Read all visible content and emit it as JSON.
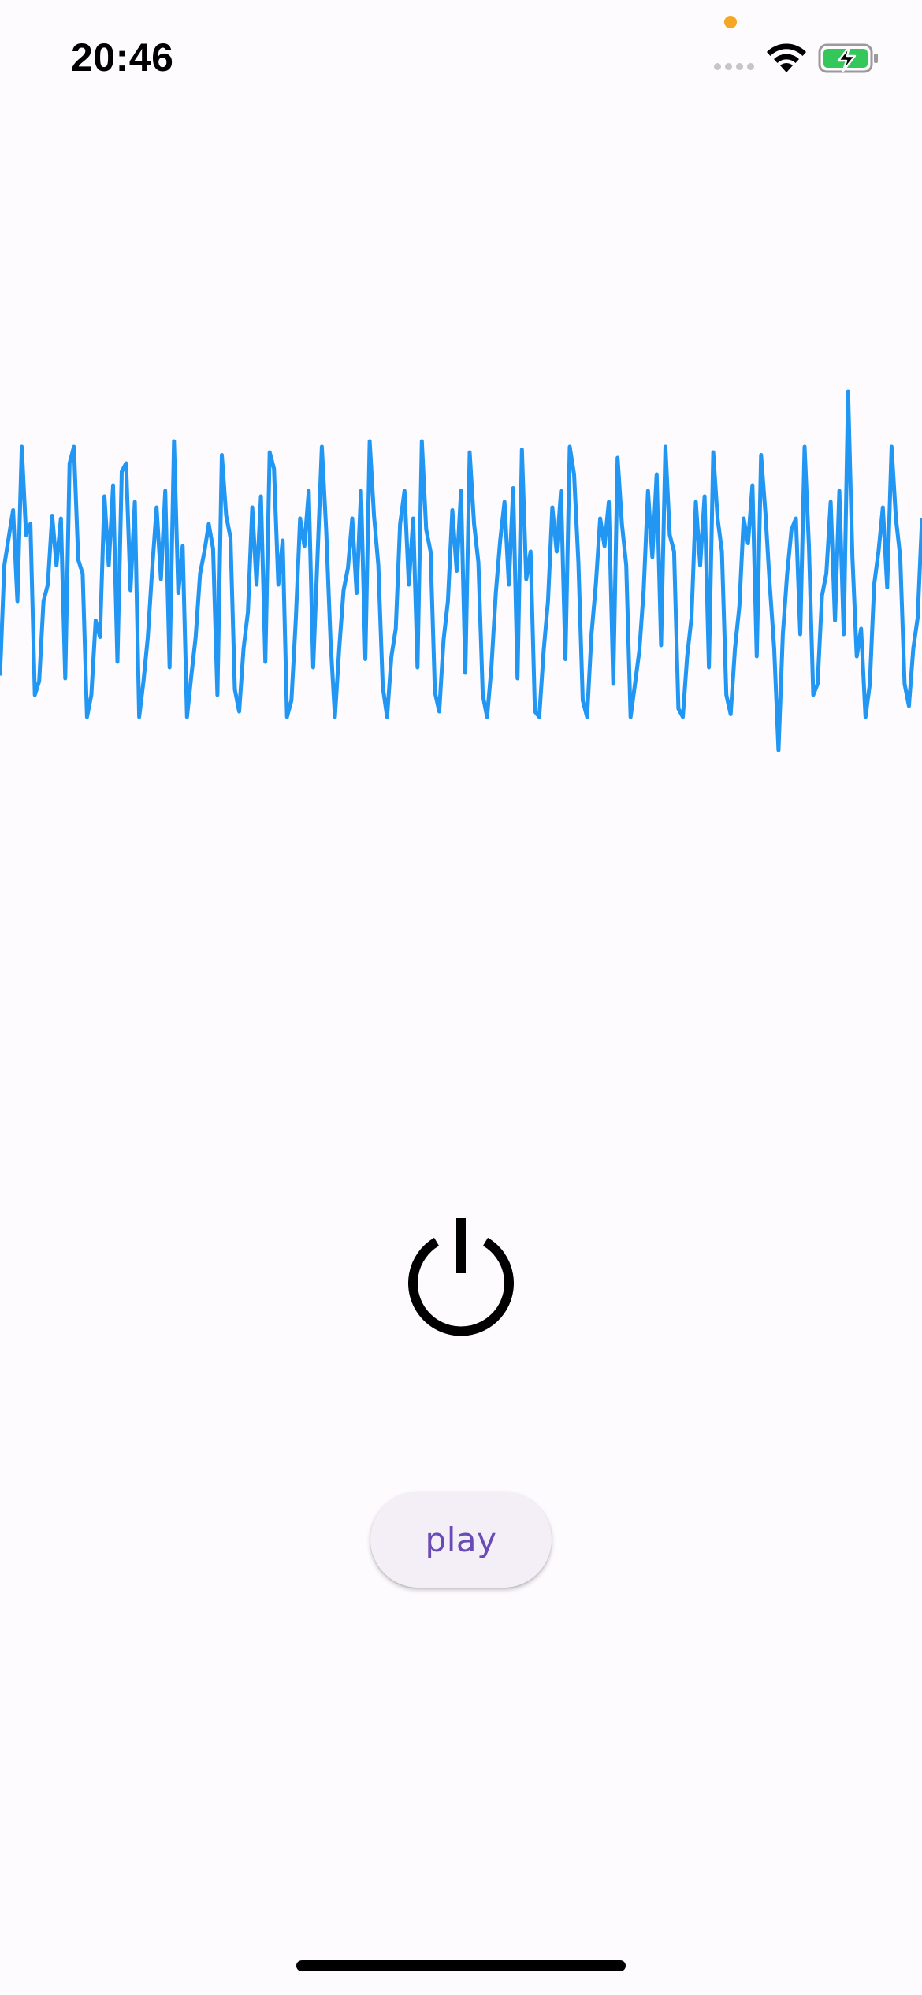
{
  "status_bar": {
    "time": "20:46",
    "wifi_icon": "wifi-icon",
    "battery_icon": "battery-charging-icon",
    "privacy_indicator_color": "#f5a623",
    "battery_color": "#34c759"
  },
  "waveform": {
    "color": "#2196f3",
    "samples": [
      0.15,
      0.55,
      0.65,
      0.75,
      0.42,
      0.98,
      0.66,
      0.7,
      0.08,
      0.13,
      0.42,
      0.48,
      0.73,
      0.55,
      0.72,
      0.14,
      0.92,
      0.98,
      0.57,
      0.52,
      0.0,
      0.08,
      0.35,
      0.29,
      0.8,
      0.55,
      0.84,
      0.2,
      0.89,
      0.92,
      0.46,
      0.78,
      0.0,
      0.13,
      0.29,
      0.54,
      0.76,
      0.5,
      0.82,
      0.18,
      1.0,
      0.45,
      0.62,
      0.0,
      0.15,
      0.29,
      0.52,
      0.6,
      0.7,
      0.61,
      0.08,
      0.95,
      0.73,
      0.65,
      0.1,
      0.02,
      0.25,
      0.38,
      0.76,
      0.48,
      0.8,
      0.2,
      0.96,
      0.9,
      0.48,
      0.64,
      0.0,
      0.06,
      0.35,
      0.72,
      0.62,
      0.82,
      0.18,
      0.58,
      0.98,
      0.68,
      0.28,
      0.0,
      0.25,
      0.46,
      0.54,
      0.72,
      0.45,
      0.82,
      0.21,
      1.0,
      0.73,
      0.55,
      0.11,
      0.0,
      0.22,
      0.32,
      0.7,
      0.82,
      0.48,
      0.72,
      0.18,
      1.0,
      0.68,
      0.6,
      0.09,
      0.02,
      0.28,
      0.42,
      0.75,
      0.53,
      0.82,
      0.16,
      0.96,
      0.7,
      0.56,
      0.08,
      0.0,
      0.18,
      0.45,
      0.64,
      0.78,
      0.48,
      0.83,
      0.14,
      0.97,
      0.5,
      0.6,
      0.02,
      0.0,
      0.24,
      0.42,
      0.76,
      0.6,
      0.82,
      0.21,
      0.98,
      0.88,
      0.56,
      0.06,
      0.0,
      0.3,
      0.48,
      0.72,
      0.62,
      0.78,
      0.12,
      0.94,
      0.7,
      0.55,
      0.0,
      0.12,
      0.24,
      0.46,
      0.82,
      0.58,
      0.88,
      0.26,
      0.98,
      0.66,
      0.6,
      0.03,
      0.0,
      0.22,
      0.36,
      0.78,
      0.55,
      0.8,
      0.18,
      0.96,
      0.72,
      0.6,
      0.08,
      0.01,
      0.25,
      0.4,
      0.72,
      0.63,
      0.84,
      0.22,
      0.95,
      0.74,
      0.48,
      0.25,
      -0.12,
      0.3,
      0.52,
      0.68,
      0.72,
      0.3,
      0.98,
      0.62,
      0.08,
      0.12,
      0.44,
      0.52,
      0.78,
      0.35,
      0.82,
      0.3,
      1.18,
      0.58,
      0.22,
      0.32,
      0.0,
      0.12,
      0.48,
      0.6,
      0.76,
      0.47,
      0.98,
      0.72,
      0.58,
      0.12,
      0.04,
      0.25,
      0.36,
      0.72
    ]
  },
  "power_icon": "power-icon",
  "play_button": {
    "label": "play"
  }
}
